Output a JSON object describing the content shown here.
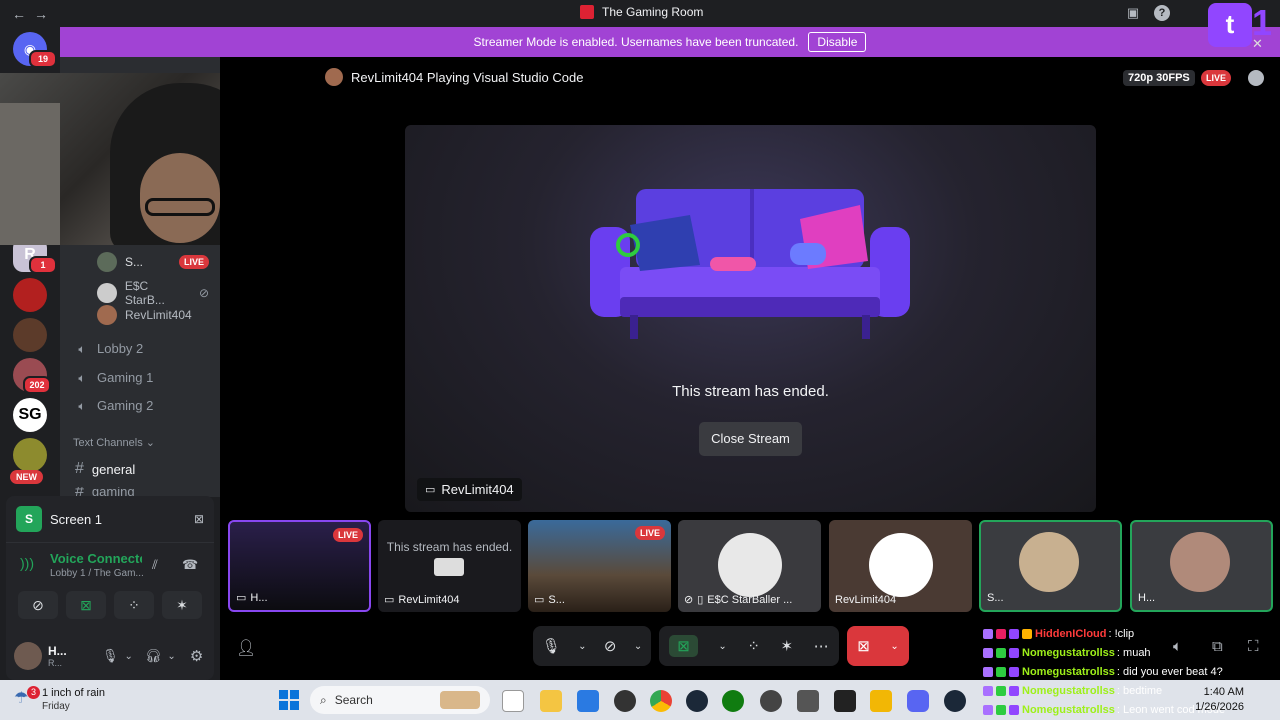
{
  "window": {
    "title": "The Gaming Room"
  },
  "banner": {
    "text": "Streamer Mode is enabled. Usernames have been truncated.",
    "button": "Disable"
  },
  "twitch_overlay": {
    "count": "1"
  },
  "servers": [
    {
      "badge": "19"
    },
    {
      "badge": "1",
      "letter": "R"
    },
    {
      "badge": ""
    },
    {
      "badge": ""
    },
    {
      "badge": "202"
    },
    {
      "letter": "SG"
    },
    {
      "badge": "NEW"
    }
  ],
  "channels": {
    "live_users": [
      {
        "name": "S...",
        "live": "LIVE"
      },
      {
        "name": "E$C StarB..."
      },
      {
        "name": "RevLimit404"
      }
    ],
    "voice": [
      "Lobby 2",
      "Gaming 1",
      "Gaming 2"
    ],
    "text_header": "Text Channels",
    "text": [
      "general",
      "gaming"
    ]
  },
  "panel": {
    "screen_label": "Screen 1",
    "voice_status": "Voice Connecte",
    "voice_location": "Lobby 1 / The Gam...",
    "user_name": "H...",
    "user_status": "R..."
  },
  "stage": {
    "stream_title": "RevLimit404 Playing Visual Studio Code",
    "quality": "720p 30FPS",
    "live": "LIVE",
    "ended_message": "This stream has ended.",
    "close_button": "Close Stream",
    "owner": "RevLimit404"
  },
  "tiles": [
    {
      "label": "H...",
      "live": "LIVE"
    },
    {
      "label": "RevLimit404",
      "overlay_text": "This stream has ended.",
      "overlay_button": "Close Stream"
    },
    {
      "label": "S...",
      "live": "LIVE"
    },
    {
      "label": "E$C StarBaller ..."
    },
    {
      "label": "RevLimit404"
    },
    {
      "label": "S..."
    },
    {
      "label": "H..."
    }
  ],
  "chat": [
    {
      "user": "HiddenICloud",
      "msg": " : !clip",
      "color": "#ff3b3b"
    },
    {
      "user": "Nomegustatrollss",
      "msg": " : muah",
      "color": "#9ef01a"
    },
    {
      "user": "Nomegustatrollss",
      "msg": " : did you ever beat 4?",
      "color": "#9ef01a"
    },
    {
      "user": "Nomegustatrollss",
      "msg": " : bedtime",
      "color": "#9ef01a"
    },
    {
      "user": "Nomegustatrollss",
      "msg": " : Leon went cod mode",
      "color": "#9ef01a"
    }
  ],
  "taskbar": {
    "weather_badge": "3",
    "weather": "1 inch of rain",
    "weather_day": "Friday",
    "search_placeholder": "Search",
    "time": "1:40 AM",
    "date": "1/26/2026"
  },
  "colors": {
    "accent": "#a143d4",
    "live": "#da373c",
    "connected": "#23a55a",
    "twitch": "#9146ff"
  }
}
